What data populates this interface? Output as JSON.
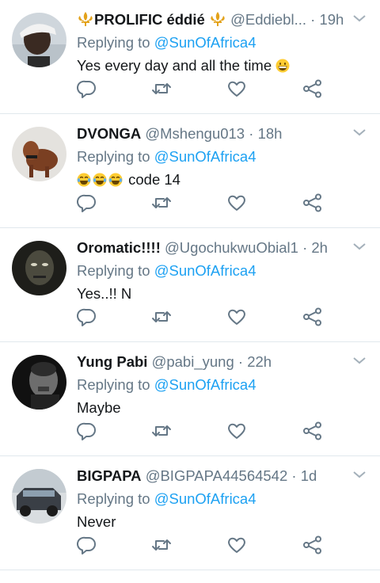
{
  "colors": {
    "link": "#1da1f2",
    "muted": "#657786",
    "text": "#14171a",
    "divider": "#e1e8ed",
    "icon": "#657786"
  },
  "replies": [
    {
      "name": "PROLIFIC éddié",
      "name_decoration": "fleur-de-lis-icon",
      "handle": "@Eddiebl...",
      "time": "19h",
      "replying_label": "Replying to",
      "replying_to": "@SunOfAfrica4",
      "text": "Yes every day and all the time",
      "text_emoji": "grinning-face-icon"
    },
    {
      "name": "DVONGA",
      "handle": "@Mshengu013",
      "time": "18h",
      "replying_label": "Replying to",
      "replying_to": "@SunOfAfrica4",
      "text": "code 14",
      "text_emoji": "tears-of-joy-icon"
    },
    {
      "name": "Oromatic!!!!",
      "handle": "@UgochukwuObial1",
      "time": "2h",
      "replying_label": "Replying to",
      "replying_to": "@SunOfAfrica4",
      "text": "Yes..!! N"
    },
    {
      "name": "Yung Pabi",
      "handle": "@pabi_yung",
      "time": "22h",
      "replying_label": "Replying to",
      "replying_to": "@SunOfAfrica4",
      "text": "Maybe"
    },
    {
      "name": "BIGPAPA",
      "handle": "@BIGPAPA44564542",
      "time": "1d",
      "replying_label": "Replying to",
      "replying_to": "@SunOfAfrica4",
      "text": "Never"
    }
  ],
  "separator": "·",
  "action_icons": [
    "reply-icon",
    "retweet-icon",
    "like-icon",
    "share-icon"
  ]
}
